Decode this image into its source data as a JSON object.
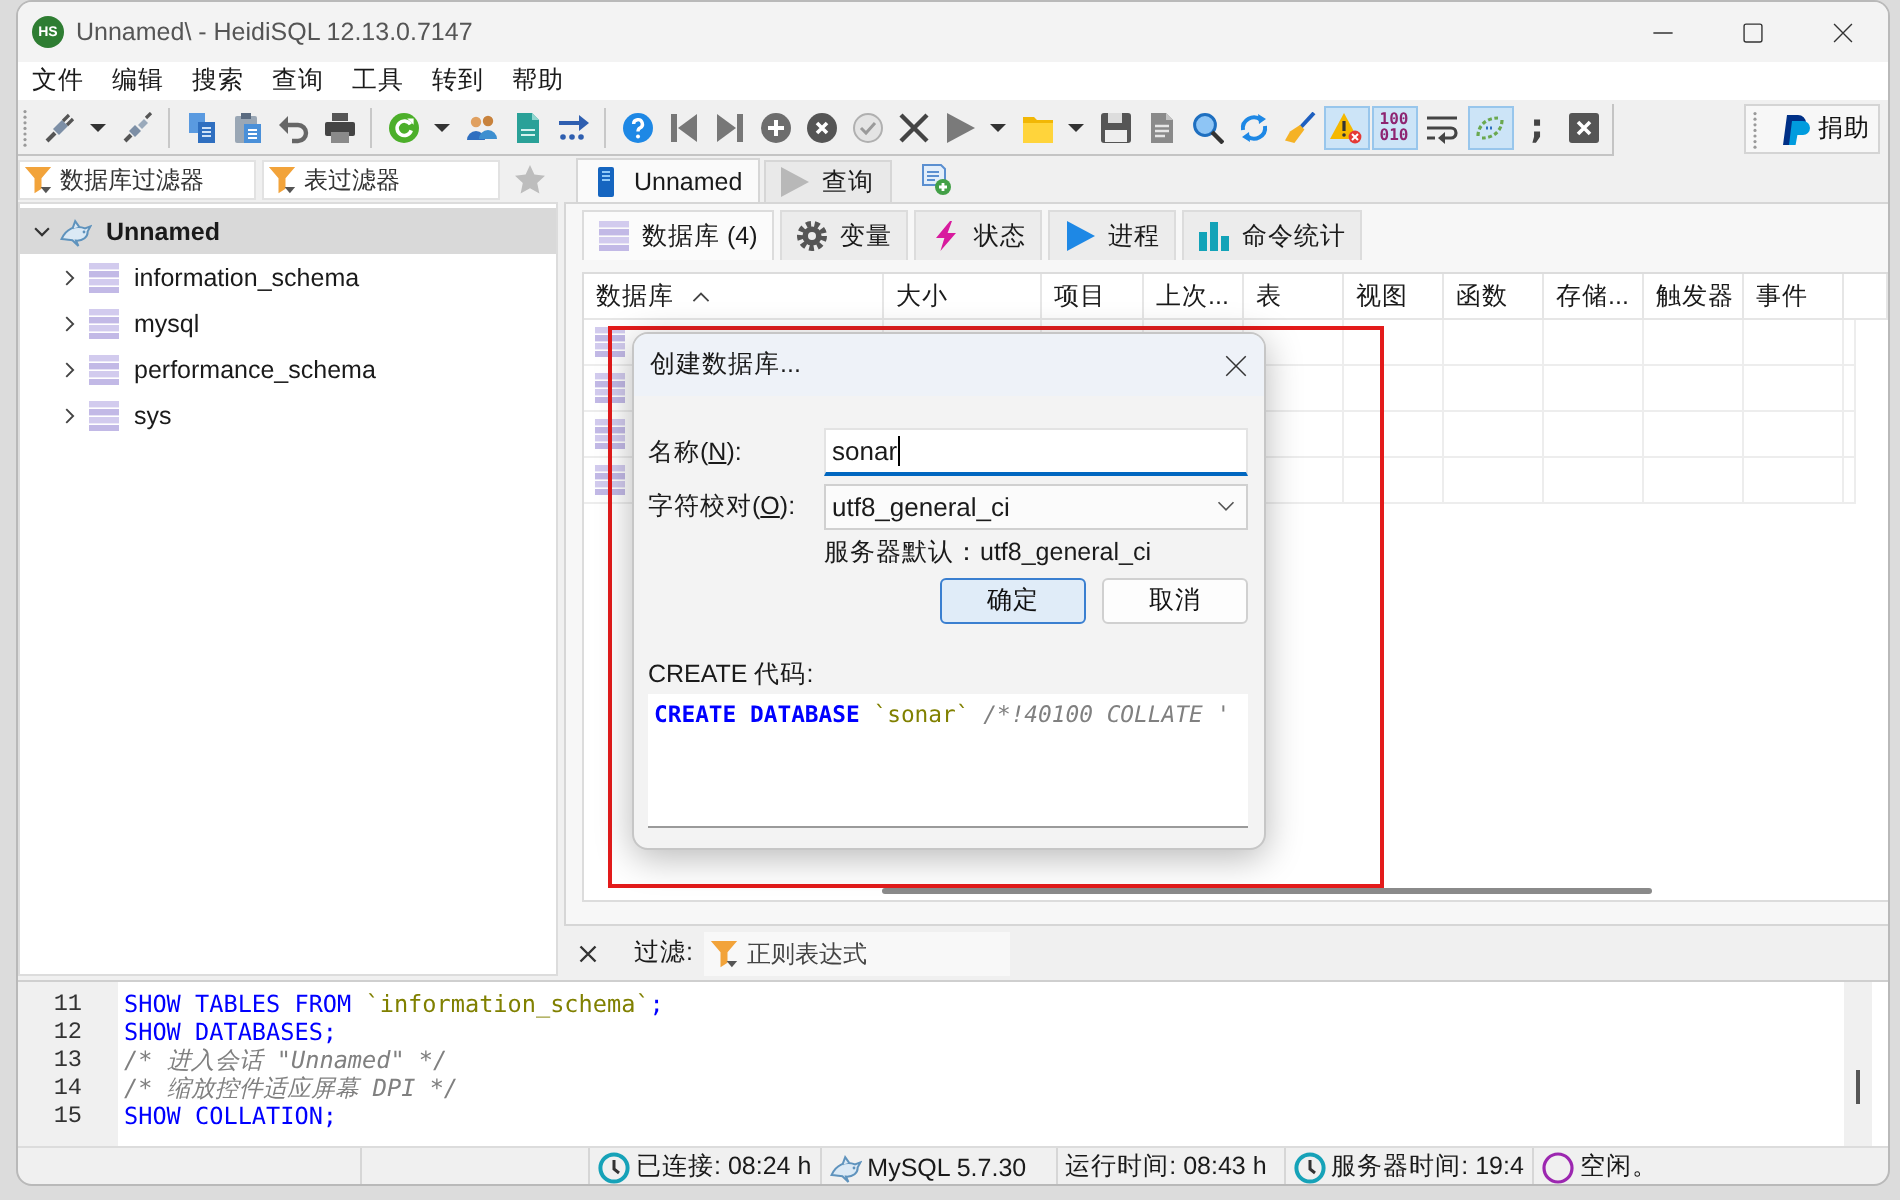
{
  "window": {
    "logo": "HS",
    "title": "Unnamed\\ - HeidiSQL 12.13.0.7147"
  },
  "menu": [
    {
      "label": "文件"
    },
    {
      "label": "编辑"
    },
    {
      "label": "搜索"
    },
    {
      "label": "查询"
    },
    {
      "label": "工具"
    },
    {
      "label": "转到"
    },
    {
      "label": "帮助"
    }
  ],
  "toolbar": {
    "warning_toggle": {
      "pressed": true
    },
    "binary_toggle": {
      "label": [
        "100",
        "010"
      ],
      "pressed": true
    },
    "wrap_toggle": {
      "pressed": false
    },
    "sync_toggle": {
      "pressed": true
    },
    "semicolon_button": {
      "label": ";"
    }
  },
  "donate_button": {
    "label": "捐助"
  },
  "sidebar": {
    "filters": [
      {
        "placeholder": "数据库过滤器"
      },
      {
        "placeholder": "表过滤器"
      }
    ],
    "tree": [
      {
        "label": "Unnamed",
        "selected": true,
        "expanded": true,
        "children": [
          {
            "label": "information_schema",
            "selected": false,
            "expanded": false
          },
          {
            "label": "mysql",
            "selected": false,
            "expanded": false
          },
          {
            "label": "performance_schema",
            "selected": false,
            "expanded": false
          },
          {
            "label": "sys",
            "selected": false,
            "expanded": false
          }
        ]
      }
    ]
  },
  "tabs": [
    {
      "kind": "host",
      "label": "Unnamed",
      "selected": true
    },
    {
      "kind": "query",
      "label": "查询",
      "selected": false
    }
  ],
  "subtabs": [
    {
      "kind": "databases",
      "label": "数据库 (4)",
      "selected": true
    },
    {
      "kind": "variables",
      "label": "变量",
      "selected": false
    },
    {
      "kind": "status",
      "label": "状态",
      "selected": false
    },
    {
      "kind": "processes",
      "label": "进程",
      "selected": false
    },
    {
      "kind": "commands",
      "label": "命令统计",
      "selected": false
    }
  ],
  "table": {
    "columns": [
      {
        "label": "数据库",
        "sorted": true
      },
      {
        "label": "大小",
        "sorted": false
      },
      {
        "label": "项目",
        "sorted": false
      },
      {
        "label": "上次...",
        "sorted": false
      },
      {
        "label": "表",
        "sorted": false
      },
      {
        "label": "视图",
        "sorted": false
      },
      {
        "label": "函数",
        "sorted": false
      },
      {
        "label": "存储...",
        "sorted": false
      },
      {
        "label": "触发器",
        "sorted": false
      },
      {
        "label": "事件",
        "sorted": false
      }
    ]
  },
  "filter": {
    "label": "过滤:",
    "placeholder": "正则表达式"
  },
  "sql_log": {
    "lines": [
      {
        "number": "11",
        "tokens": [
          {
            "kind": "keyword",
            "text": "SHOW TABLES FROM "
          },
          {
            "kind": "identifier",
            "text": "`information_schema`"
          },
          {
            "kind": "keyword",
            "text": ";"
          }
        ]
      },
      {
        "number": "12",
        "tokens": [
          {
            "kind": "keyword",
            "text": "SHOW DATABASES;"
          }
        ]
      },
      {
        "number": "13",
        "tokens": [
          {
            "kind": "comment",
            "text": "/* 进入会话 \"Unnamed\" */"
          }
        ]
      },
      {
        "number": "14",
        "tokens": [
          {
            "kind": "comment",
            "text": "/* 缩放控件适应屏幕 DPI */"
          }
        ]
      },
      {
        "number": "15",
        "tokens": [
          {
            "kind": "keyword",
            "text": "SHOW COLLATION;"
          }
        ]
      }
    ]
  },
  "status_bar": {
    "panels": [
      {
        "kind": "empty"
      },
      {
        "kind": "empty"
      },
      {
        "kind": "clock",
        "text": "已连接: 08:24 h"
      },
      {
        "kind": "server",
        "text": "MySQL 5.7.30"
      },
      {
        "kind": "plain",
        "text": "运行时间: 08:43 h"
      },
      {
        "kind": "clock",
        "text": "服务器时间: 19:4"
      },
      {
        "kind": "ring",
        "text": "空闲。"
      }
    ]
  },
  "dialog": {
    "title": "创建数据库...",
    "fields": [
      {
        "kind": "text",
        "label_start": "名称(",
        "mnemonic": "N",
        "label_end": "):",
        "value": "sonar",
        "focused": true
      },
      {
        "kind": "select",
        "label_start": "字符校对(",
        "mnemonic": "O",
        "label_end": "):",
        "value": "utf8_general_ci",
        "focused": false
      }
    ],
    "hint": "服务器默认：utf8_general_ci",
    "buttons": [
      {
        "label": "确定",
        "default": true
      },
      {
        "label": "取消",
        "default": false
      }
    ],
    "code_label": "CREATE 代码:",
    "code": [
      {
        "kind": "keyword",
        "text": "CREATE DATABASE "
      },
      {
        "kind": "identifier",
        "text": "`sonar`"
      },
      {
        "kind": "comment",
        "text": " /*!40100 COLLATE '"
      }
    ]
  }
}
